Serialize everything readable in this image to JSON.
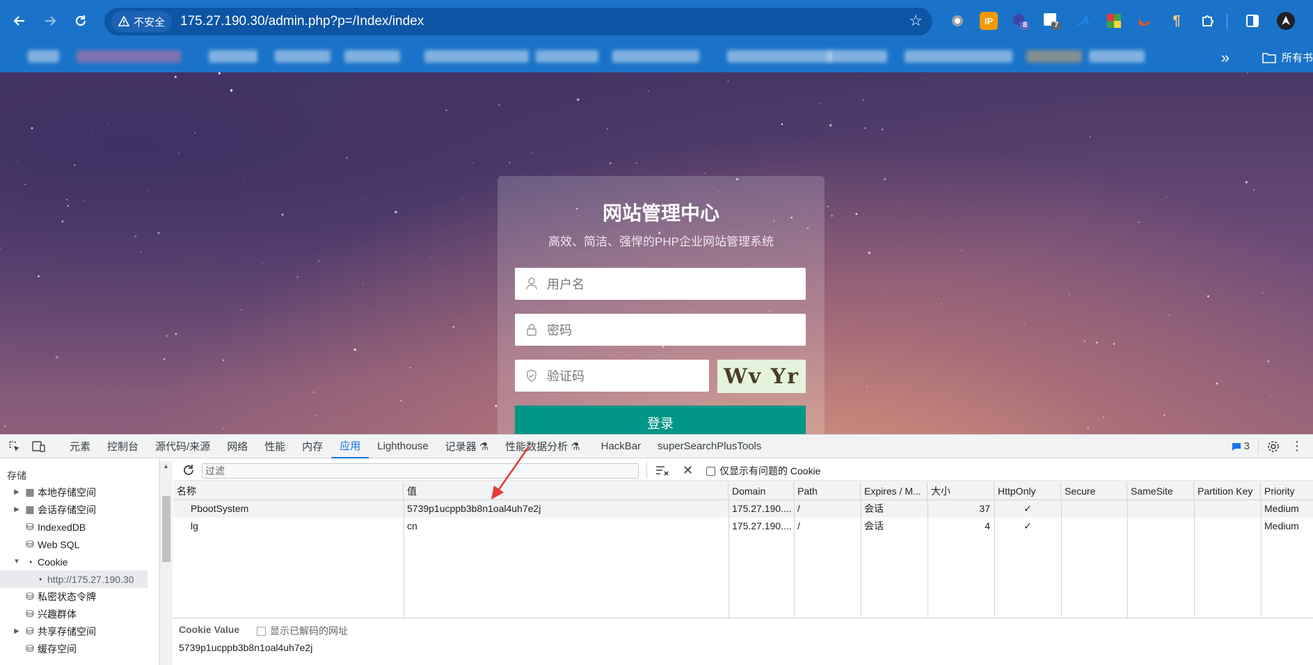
{
  "browser": {
    "security_label": "不安全",
    "url": "175.27.190.30/admin.php?p=/Index/index",
    "extensions": [
      {
        "icon": "circle-ext-icon",
        "badge": ""
      },
      {
        "icon": "ip-ext-icon",
        "label": "IP",
        "badge": ""
      },
      {
        "icon": "hex-ext-icon",
        "badge": "8"
      },
      {
        "icon": "grid-ext-icon",
        "badge": "7"
      }
    ],
    "bookmarks_all_label": "所有书"
  },
  "login": {
    "title": "网站管理中心",
    "subtitle": "高效、简洁、强悍的PHP企业网站管理系统",
    "username_placeholder": "用户名",
    "password_placeholder": "密码",
    "captcha_placeholder": "验证码",
    "captcha_text": "Wv Yr",
    "submit_label": "登录"
  },
  "devtools": {
    "tabs": [
      "元素",
      "控制台",
      "源代码/来源",
      "网络",
      "性能",
      "内存",
      "应用",
      "Lighthouse",
      "记录器",
      "性能数据分析",
      "HackBar",
      "superSearchPlusTools"
    ],
    "active_tab": "应用",
    "issues_count": "3",
    "sidebar": {
      "title": "存储",
      "items": [
        {
          "label": "本地存储空间",
          "icon": "table-icon",
          "expandable": true
        },
        {
          "label": "会话存储空间",
          "icon": "table-icon",
          "expandable": true
        },
        {
          "label": "IndexedDB",
          "icon": "database-icon",
          "expandable": false
        },
        {
          "label": "Web SQL",
          "icon": "database-icon",
          "expandable": false
        },
        {
          "label": "Cookie",
          "icon": "cookie-icon",
          "expanded": true
        },
        {
          "label": "http://175.27.190.30",
          "icon": "cookie-icon",
          "selected": true
        },
        {
          "label": "私密状态令牌",
          "icon": "database-icon"
        },
        {
          "label": "兴趣群体",
          "icon": "database-icon"
        },
        {
          "label": "共享存储空间",
          "icon": "database-icon",
          "expandable": true
        },
        {
          "label": "缓存空间",
          "icon": "database-icon"
        }
      ]
    },
    "cookie_toolbar": {
      "filter_placeholder": "过滤",
      "only_issues_label": "仅显示有问题的 Cookie"
    },
    "cookie_table": {
      "columns": [
        "名称",
        "值",
        "Domain",
        "Path",
        "Expires / M...",
        "大小",
        "HttpOnly",
        "Secure",
        "SameSite",
        "Partition Key",
        "Priority"
      ],
      "rows": [
        {
          "name": "PbootSystem",
          "value": "5739p1ucppb3b8n1oal4uh7e2j",
          "domain": "175.27.190....",
          "path": "/",
          "expires": "会话",
          "size": "37",
          "httponly": "✓",
          "secure": "",
          "samesite": "",
          "partition": "",
          "priority": "Medium"
        },
        {
          "name": "lg",
          "value": "cn",
          "domain": "175.27.190....",
          "path": "/",
          "expires": "会话",
          "size": "4",
          "httponly": "✓",
          "secure": "",
          "samesite": "",
          "partition": "",
          "priority": "Medium"
        }
      ]
    },
    "cookie_value_panel": {
      "title": "Cookie Value",
      "show_decoded_label": "显示已解码的网址",
      "value": "5739p1ucppb3b8n1oal4uh7e2j"
    }
  }
}
